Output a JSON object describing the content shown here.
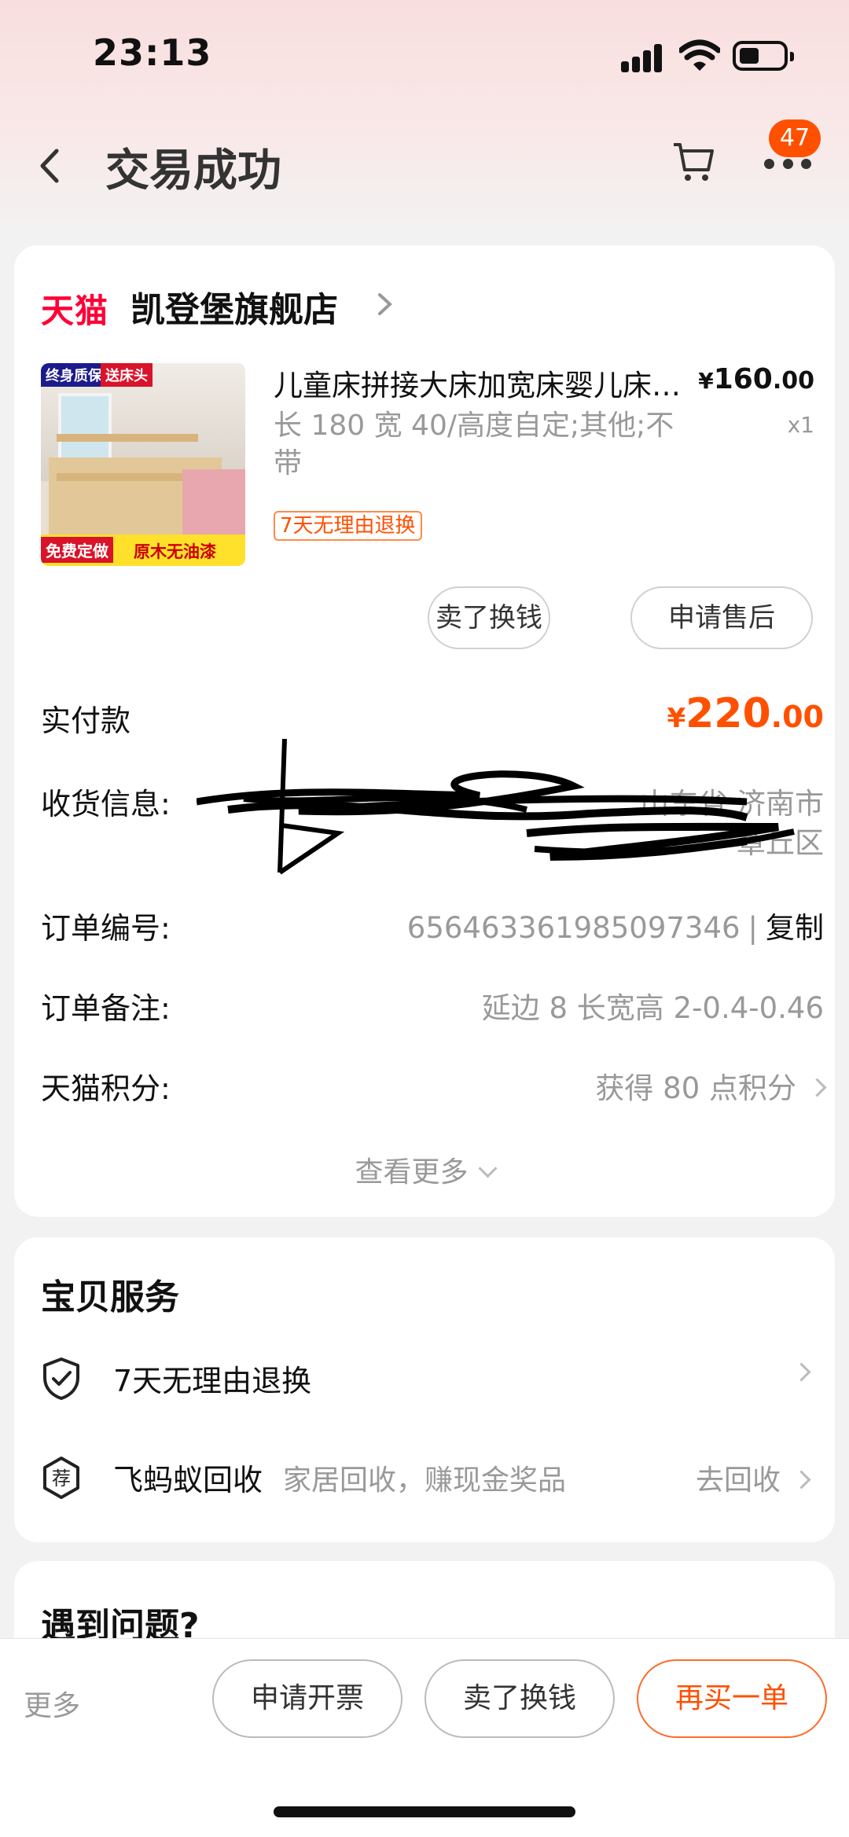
{
  "status": {
    "time": "23:13"
  },
  "nav": {
    "title": "交易成功",
    "badge_count": "47"
  },
  "store": {
    "brand": "天猫",
    "name": "凯登堡旗舰店"
  },
  "product": {
    "title": "儿童床拼接大床加宽床婴儿床带护栏",
    "spec": "长 180 宽 40/高度自定;其他;不带",
    "return_tag": "7天无理由退换",
    "price_symbol": "¥",
    "price_int": "160",
    "price_dec": ".00",
    "quantity": "x1",
    "thumb_tags": [
      "终身质保",
      "送床头"
    ],
    "thumb_strip": [
      "免费定做",
      "原木无油漆"
    ]
  },
  "order_actions": {
    "sell": "卖了换钱",
    "after_sale": "申请售后"
  },
  "payment": {
    "label": "实付款",
    "symbol": "¥",
    "int": "220",
    "dec": ".00"
  },
  "shipping": {
    "label": "收货信息:",
    "line1": "山东省 济南市",
    "line2": "章丘区"
  },
  "order_no": {
    "label": "订单编号:",
    "value": "656463361985097346",
    "separator": "|",
    "copy": "复制"
  },
  "remark": {
    "label": "订单备注:",
    "value": "延边 8 长宽高 2-0.4-0.46"
  },
  "points": {
    "label": "天猫积分:",
    "value": "获得 80 点积分"
  },
  "see_more": "查看更多",
  "service": {
    "title": "宝贝服务",
    "items": [
      {
        "icon": "shield-check-icon",
        "label": "7天无理由退换"
      },
      {
        "icon": "recycle-badge-icon",
        "icon_text": "荐",
        "label": "飞蚂蚁回收",
        "sub": "家居回收，赚现金奖品",
        "action": "去回收"
      }
    ]
  },
  "problem": {
    "title": "遇到问题?"
  },
  "bottom": {
    "more": "更多",
    "invoice": "申请开票",
    "sell": "卖了换钱",
    "rebuy": "再买一单"
  },
  "colors": {
    "accent": "#ff5000",
    "tmall_red": "#ff0036"
  }
}
